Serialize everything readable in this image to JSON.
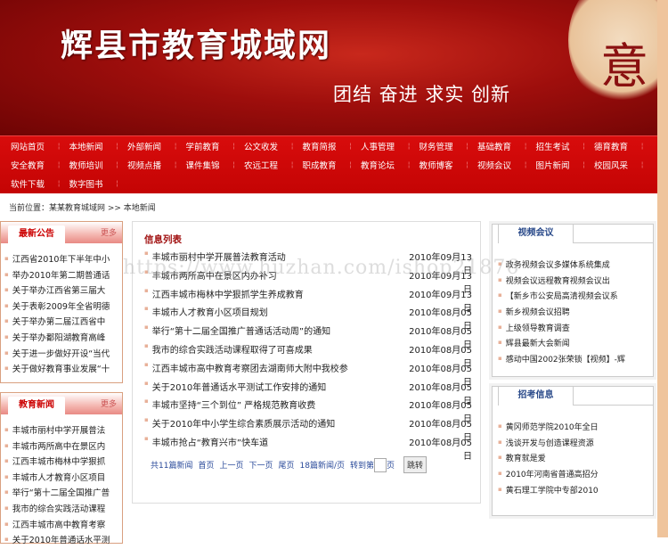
{
  "banner": {
    "title": "辉县市教育城域网",
    "slogan": "团结 奋进 求实 创新",
    "deco_char": "意"
  },
  "nav": {
    "rows": [
      [
        "网站首页",
        "本地新闻",
        "外部新闻",
        "学前教育",
        "公文收发",
        "教育简报",
        "人事管理",
        "财务管理",
        "基础教育",
        "招生考试",
        "德育教育"
      ],
      [
        "安全教育",
        "教师培训",
        "视频点播",
        "课件集锦",
        "农远工程",
        "职成教育",
        "教育论坛",
        "教师博客",
        "视频会议",
        "图片新闻",
        "校园风采"
      ],
      [
        "软件下载",
        "数字图书"
      ]
    ]
  },
  "breadcrumb": "当前位置：某某教育城域网 >> 本地新闻",
  "left": {
    "notice": {
      "title": "最新公告",
      "more": "更多",
      "items": [
        "江西省2010年下半年中小",
        "举办2010年第二期普通话",
        "关于举办江西省第三届大",
        "关于表彰2009年全省明德",
        "关于举办第二届江西省中",
        "关于举办鄱阳湖教育高峰",
        "关于进一步做好开设“当代",
        "关于做好教育事业发展“十"
      ]
    },
    "news": {
      "title": "教育新闻",
      "more": "更多",
      "items": [
        "丰城市丽村中学开展普法",
        "丰城市两所高中在景区内",
        "江西丰城市梅林中学狠抓",
        "丰城市人才教育小区项目",
        "举行“第十二届全国推广普",
        "我市的综合实践活动课程",
        "江西丰城市高中教育考察",
        "关于2010年普通话水平测"
      ]
    }
  },
  "center": {
    "title": "信息列表",
    "items": [
      {
        "t": "丰城市丽村中学开展普法教育活动",
        "d": "2010年09月13日"
      },
      {
        "t": "丰城市两所高中在景区内办补习",
        "d": "2010年09月13日"
      },
      {
        "t": "江西丰城市梅林中学狠抓学生养成教育",
        "d": "2010年09月13日"
      },
      {
        "t": "丰城市人才教育小区项目规划",
        "d": "2010年08月05日"
      },
      {
        "t": "举行“第十二届全国推广普通话活动周”的通知",
        "d": "2010年08月05日"
      },
      {
        "t": "我市的综合实践活动课程取得了可喜成果",
        "d": "2010年08月05日"
      },
      {
        "t": "江西丰城市高中教育考察团去湖南师大附中我校参",
        "d": "2010年08月05日"
      },
      {
        "t": "关于2010年普通话水平测试工作安排的通知",
        "d": "2010年08月05日"
      },
      {
        "t": "丰城市坚持“三个到位” 严格规范教育收费",
        "d": "2010年08月05日"
      },
      {
        "t": "关于2010年中小学生综合素质展示活动的通知",
        "d": "2010年08月05日"
      },
      {
        "t": "丰城市抢占“教育兴市”快车道",
        "d": "2010年08月05日"
      }
    ],
    "pager": {
      "total": "共11篇新闻",
      "first": "首页",
      "prev": "上一页",
      "next": "下一页",
      "last": "尾页",
      "per": "18篇新闻/页",
      "goto": "转到第",
      "page": "页",
      "jump": "跳转"
    }
  },
  "right": {
    "video": {
      "title": "视频会议",
      "items": [
        "政务视频会议多媒体系统集成",
        "视频会议远程教育视频会议出",
        "【新乡市公安局高清视频会议系",
        "新乡视频会议招聘",
        "上级领导教育调查",
        "辉县最新大会新闻",
        "感动中国2002张荣锁【视频】-辉"
      ]
    },
    "exam": {
      "title": "招考信息",
      "items": [
        "黄冈师范学院2010年全日",
        "浅谈开发与创造课程资源",
        "教育就是爱",
        "2010年河南省普通高招分",
        "黄石理工学院中专部2010"
      ]
    }
  },
  "watermark": "https://www.huzhan.com/ishop21876"
}
